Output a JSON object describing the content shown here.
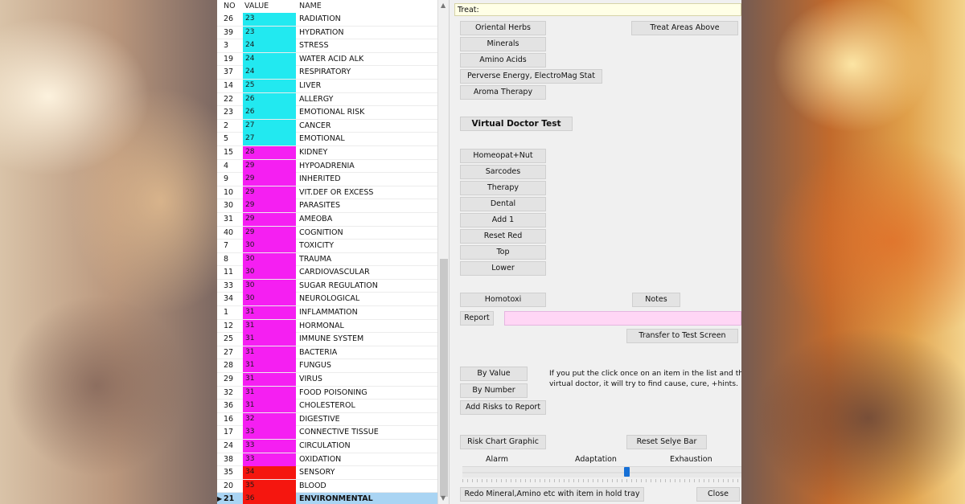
{
  "list": {
    "columns": {
      "no": "NO",
      "value": "VALUE",
      "name": "NAME"
    },
    "rows": [
      {
        "no": "26",
        "value": "23",
        "name": "RADIATION",
        "color": "#22e9f0"
      },
      {
        "no": "39",
        "value": "23",
        "name": "HYDRATION",
        "color": "#22e9f0"
      },
      {
        "no": "3",
        "value": "24",
        "name": "STRESS",
        "color": "#22e9f0"
      },
      {
        "no": "19",
        "value": "24",
        "name": "WATER ACID ALK",
        "color": "#22e9f0"
      },
      {
        "no": "37",
        "value": "24",
        "name": "RESPIRATORY",
        "color": "#22e9f0"
      },
      {
        "no": "14",
        "value": "25",
        "name": "LIVER",
        "color": "#22e9f0"
      },
      {
        "no": "22",
        "value": "26",
        "name": "ALLERGY",
        "color": "#22e9f0"
      },
      {
        "no": "23",
        "value": "26",
        "name": "EMOTIONAL RISK",
        "color": "#22e9f0"
      },
      {
        "no": "2",
        "value": "27",
        "name": "CANCER",
        "color": "#22e9f0"
      },
      {
        "no": "5",
        "value": "27",
        "name": "EMOTIONAL",
        "color": "#22e9f0"
      },
      {
        "no": "15",
        "value": "28",
        "name": "KIDNEY",
        "color": "#f51ff2"
      },
      {
        "no": "4",
        "value": "29",
        "name": "HYPOADRENIA",
        "color": "#f51ff2"
      },
      {
        "no": "9",
        "value": "29",
        "name": "INHERITED",
        "color": "#f51ff2"
      },
      {
        "no": "10",
        "value": "29",
        "name": "VIT.DEF OR EXCESS",
        "color": "#f51ff2"
      },
      {
        "no": "30",
        "value": "29",
        "name": "PARASITES",
        "color": "#f51ff2"
      },
      {
        "no": "31",
        "value": "29",
        "name": "AMEOBA",
        "color": "#f51ff2"
      },
      {
        "no": "40",
        "value": "29",
        "name": "COGNITION",
        "color": "#f51ff2"
      },
      {
        "no": "7",
        "value": "30",
        "name": "TOXICITY",
        "color": "#f51ff2"
      },
      {
        "no": "8",
        "value": "30",
        "name": "TRAUMA",
        "color": "#f51ff2"
      },
      {
        "no": "11",
        "value": "30",
        "name": "CARDIOVASCULAR",
        "color": "#f51ff2"
      },
      {
        "no": "33",
        "value": "30",
        "name": "SUGAR REGULATION",
        "color": "#f51ff2"
      },
      {
        "no": "34",
        "value": "30",
        "name": "NEUROLOGICAL",
        "color": "#f51ff2"
      },
      {
        "no": "1",
        "value": "31",
        "name": "INFLAMMATION",
        "color": "#f51ff2"
      },
      {
        "no": "12",
        "value": "31",
        "name": "HORMONAL",
        "color": "#f51ff2"
      },
      {
        "no": "25",
        "value": "31",
        "name": "IMMUNE SYSTEM",
        "color": "#f51ff2"
      },
      {
        "no": "27",
        "value": "31",
        "name": "BACTERIA",
        "color": "#f51ff2"
      },
      {
        "no": "28",
        "value": "31",
        "name": "FUNGUS",
        "color": "#f51ff2"
      },
      {
        "no": "29",
        "value": "31",
        "name": "VIRUS",
        "color": "#f51ff2"
      },
      {
        "no": "32",
        "value": "31",
        "name": "FOOD POISONING",
        "color": "#f51ff2"
      },
      {
        "no": "36",
        "value": "31",
        "name": "CHOLESTEROL",
        "color": "#f51ff2"
      },
      {
        "no": "16",
        "value": "32",
        "name": "DIGESTIVE",
        "color": "#f51ff2"
      },
      {
        "no": "17",
        "value": "33",
        "name": "CONNECTIVE TISSUE",
        "color": "#f51ff2"
      },
      {
        "no": "24",
        "value": "33",
        "name": "CIRCULATION",
        "color": "#f51ff2"
      },
      {
        "no": "38",
        "value": "33",
        "name": "OXIDATION",
        "color": "#f51ff2"
      },
      {
        "no": "35",
        "value": "34",
        "name": "SENSORY",
        "color": "#f5160f"
      },
      {
        "no": "20",
        "value": "35",
        "name": "BLOOD",
        "color": "#f5160f"
      },
      {
        "no": "21",
        "value": "36",
        "name": "ENVIRONMENTAL",
        "color": "#f5160f",
        "selected": true
      }
    ]
  },
  "panel": {
    "treat_label": "Treat:",
    "buttons": {
      "oriental_herbs": "Oriental Herbs",
      "treat_areas_above": "Treat Areas Above",
      "minerals": "Minerals",
      "amino_acids": "Amino Acids",
      "perverse_energy": "Perverse Energy, ElectroMag Stat",
      "aroma_therapy": "Aroma Therapy",
      "virtual_doctor_test": "Virtual Doctor Test",
      "homeopat_nut": "Homeopat+Nut",
      "sarcodes": "Sarcodes",
      "therapy": "Therapy",
      "dental": "Dental",
      "add_1": "Add 1",
      "reset_red": "Reset Red",
      "top": "Top",
      "lower": "Lower",
      "homotoxi": "Homotoxi",
      "notes": "Notes",
      "report": "Report",
      "transfer_to_test_screen": "Transfer to Test Screen",
      "by_value": "By Value",
      "by_number": "By Number",
      "add_risks_to_report": "Add Risks to Report",
      "risk_chart_graphic": "Risk Chart Graphic",
      "reset_selye_bar": "Reset Selye Bar",
      "redo_mineral": "Redo Mineral,Amino etc with item in hold tray",
      "close": "Close"
    },
    "info_line1": "If you put the click once on an item in the list and then",
    "info_line2": "virtual doctor, it will try to find cause, cure, +hints.",
    "selye": {
      "alarm": "Alarm",
      "adaptation": "Adaptation",
      "exhaustion": "Exhaustion",
      "level": 0.59
    }
  }
}
